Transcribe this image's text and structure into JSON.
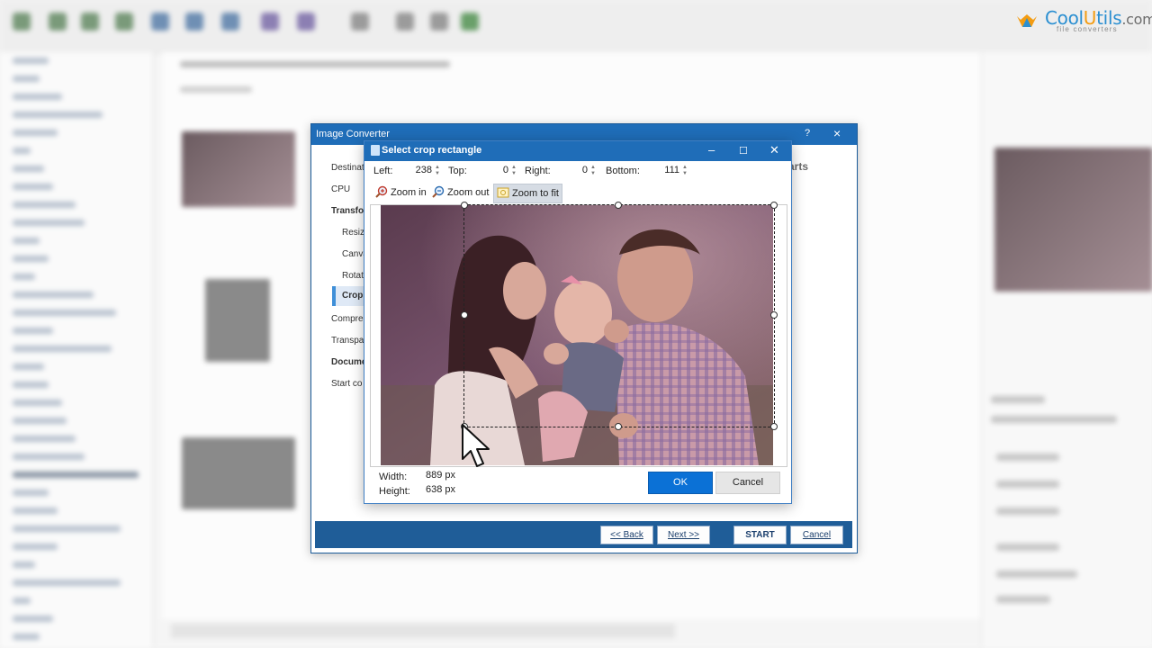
{
  "logo": {
    "part1": "Cool",
    "part2": "U",
    "part3": "tils",
    "part4": ".com",
    "tagline": "file converters"
  },
  "wizard": {
    "title": "Image Converter",
    "help": "?",
    "close": "×",
    "nav": [
      {
        "label": "Destinati",
        "style": "normal"
      },
      {
        "label": "CPU",
        "style": "normal"
      },
      {
        "label": "Transfo",
        "style": "bold"
      },
      {
        "label": "Resize",
        "style": "sub"
      },
      {
        "label": "Canva",
        "style": "sub"
      },
      {
        "label": "Rotate",
        "style": "sub"
      },
      {
        "label": "Crop",
        "style": "active"
      },
      {
        "label": "Compres",
        "style": "normal"
      },
      {
        "label": "Transpa",
        "style": "normal"
      },
      {
        "label": "Docume",
        "style": "bold"
      },
      {
        "label": "Start co",
        "style": "normal"
      }
    ],
    "parts_label": "arts",
    "buttons": {
      "back": "<< Back",
      "next": "Next >>",
      "start": "START",
      "cancel": "Cancel"
    }
  },
  "crop": {
    "title": "Select crop rectangle",
    "controls": {
      "minimize": "–",
      "maximize": "☐",
      "close": "✕"
    },
    "fields": {
      "left_label": "Left:",
      "left_value": "238",
      "top_label": "Top:",
      "top_value": "0",
      "right_label": "Right:",
      "right_value": "0",
      "bottom_label": "Bottom:",
      "bottom_value": "111"
    },
    "zoom": {
      "zoom_in": "Zoom in",
      "zoom_out": "Zoom out",
      "zoom_fit": "Zoom to fit"
    },
    "width_label": "Width:",
    "width_value": "889 px",
    "height_label": "Height:",
    "height_value": "638 px",
    "ok": "OK",
    "cancel": "Cancel"
  },
  "colors": {
    "titlebar": "#1f6db8",
    "ok_button": "#0b71d6",
    "bottom_bar": "#1f5d98",
    "accent": "#3f8fd8"
  }
}
